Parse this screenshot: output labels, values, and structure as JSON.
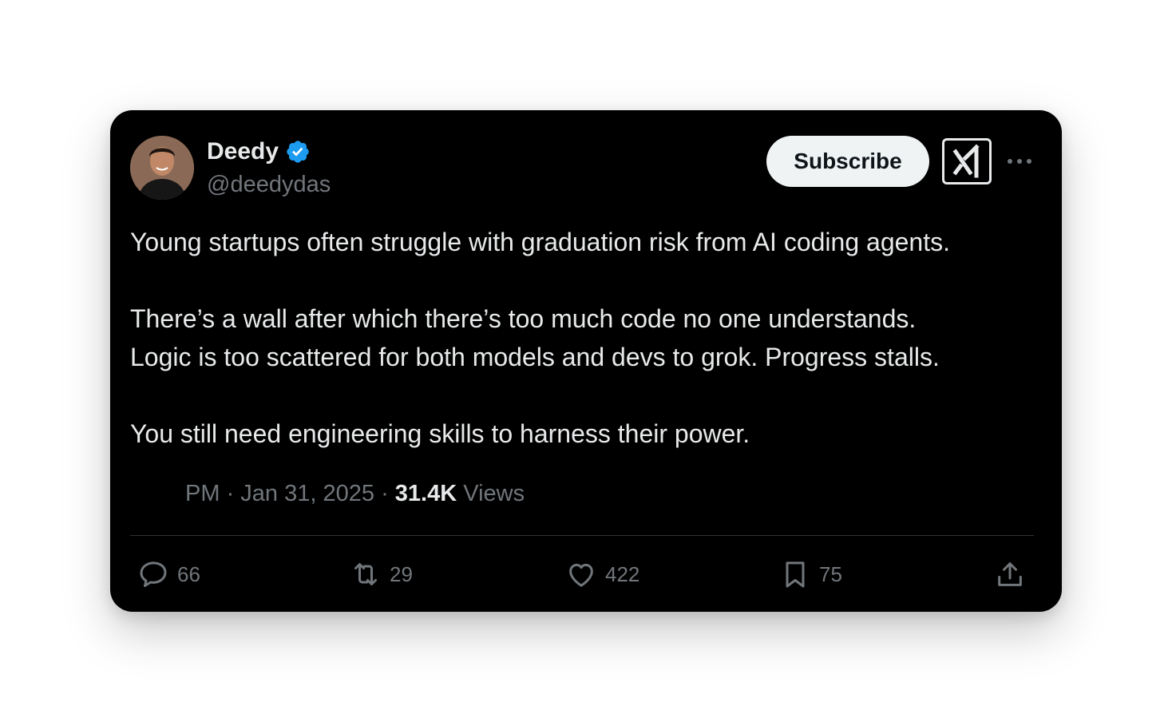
{
  "author": {
    "name": "Deedy",
    "handle": "@deedydas",
    "verified": true,
    "verified_color": "#1d9bf0"
  },
  "header": {
    "subscribe_label": "Subscribe",
    "grok_icon": "grok-icon",
    "more_icon": "more-icon"
  },
  "tweet": {
    "paragraphs": [
      "Young startups often struggle with graduation risk from AI coding agents.",
      "There’s a wall after which there’s too much code no one understands.",
      "Logic is too scattered for both models and devs to grok. Progress stalls.",
      "You still need engineering skills to harness their power."
    ]
  },
  "meta": {
    "time": "PM",
    "separator": "·",
    "date": "Jan 31, 2025",
    "views_count": "31.4K",
    "views_label": "Views"
  },
  "actions": {
    "replies": "66",
    "reposts": "29",
    "likes": "422",
    "bookmarks": "75"
  },
  "colors": {
    "card_bg": "#000000",
    "text_primary": "#e7e9ea",
    "text_secondary": "#71767b",
    "divider": "#2f3336",
    "subscribe_bg": "#eff3f4"
  }
}
